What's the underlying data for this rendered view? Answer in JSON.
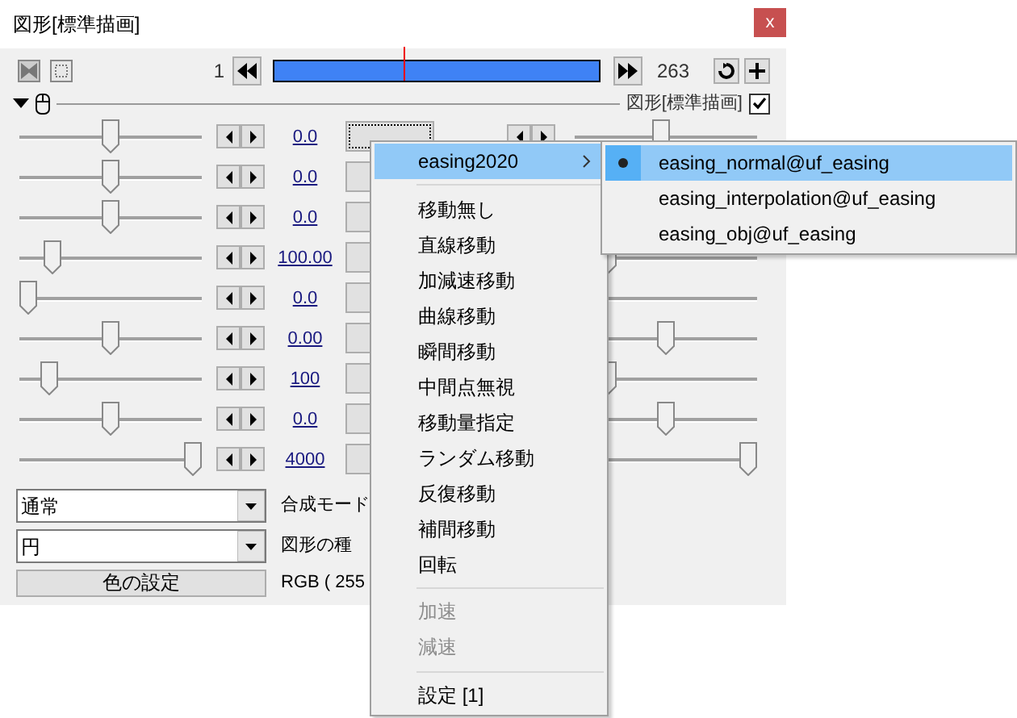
{
  "window": {
    "title": "図形[標準描画]",
    "close": "x"
  },
  "toolbar": {
    "start_frame": "1",
    "end_frame": "263",
    "timeline": {
      "level": 0.4
    }
  },
  "header": {
    "expanded": true,
    "label": "図形[標準描画]",
    "checked": true
  },
  "rows": [
    {
      "value": "0.0",
      "level": 0.5,
      "focused": true,
      "right_spin": true,
      "right_slider": {
        "level": 0.47
      }
    },
    {
      "value": "0.0",
      "level": 0.5
    },
    {
      "value": "0.0",
      "level": 0.5
    },
    {
      "value": "100.00",
      "level": 0.15,
      "right_slider": {
        "level": 0.15
      }
    },
    {
      "value": "0.0",
      "level": 0,
      "right_track": true
    },
    {
      "value": "0.00",
      "level": 0.5,
      "right_slider": {
        "level": 0.5
      }
    },
    {
      "value": "100",
      "level": 0.13,
      "right_slider": {
        "level": 0.15
      }
    },
    {
      "value": "0.0",
      "level": 0.5,
      "right_slider": {
        "level": 0.5
      }
    },
    {
      "value": "4000",
      "level": 1,
      "right_slider": {
        "level": 1
      }
    }
  ],
  "blend_mode": {
    "value": "通常",
    "label": "合成モード"
  },
  "shape_type": {
    "value": "円",
    "label": "図形の種"
  },
  "color_button": "色の設定",
  "rgb": "RGB ( 255",
  "menu": {
    "items": [
      {
        "kind": "submenu",
        "label": "easing2020",
        "selected": true
      },
      {
        "kind": "separator"
      },
      {
        "kind": "item",
        "label": "移動無し",
        "disabled": false
      },
      {
        "kind": "item",
        "label": "直線移動",
        "disabled": false
      },
      {
        "kind": "item",
        "label": "加減速移動",
        "disabled": false
      },
      {
        "kind": "item",
        "label": "曲線移動",
        "disabled": false
      },
      {
        "kind": "item",
        "label": "瞬間移動",
        "disabled": false
      },
      {
        "kind": "item",
        "label": "中間点無視",
        "disabled": false
      },
      {
        "kind": "item",
        "label": "移動量指定",
        "disabled": false
      },
      {
        "kind": "item",
        "label": "ランダム移動",
        "disabled": false
      },
      {
        "kind": "item",
        "label": "反復移動",
        "disabled": false
      },
      {
        "kind": "item",
        "label": "補間移動",
        "disabled": false
      },
      {
        "kind": "item",
        "label": "回転",
        "disabled": false
      },
      {
        "kind": "separator"
      },
      {
        "kind": "item",
        "label": "加速",
        "disabled": true
      },
      {
        "kind": "item",
        "label": "減速",
        "disabled": true
      },
      {
        "kind": "separator"
      },
      {
        "kind": "item",
        "label": "設定 [1]",
        "disabled": false
      }
    ]
  },
  "submenu": {
    "items": [
      {
        "label": "easing_normal@uf_easing",
        "selected": true,
        "checked": true
      },
      {
        "label": "easing_interpolation@uf_easing",
        "selected": false,
        "checked": false
      },
      {
        "label": "easing_obj@uf_easing",
        "selected": false,
        "checked": false
      }
    ]
  }
}
